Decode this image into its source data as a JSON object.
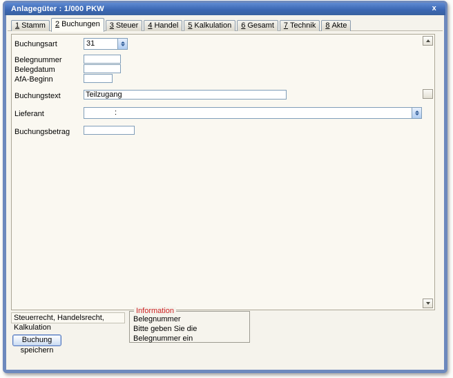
{
  "window": {
    "title": "Anlagegüter : 1/000 PKW",
    "close_label": "x"
  },
  "tabs": [
    {
      "num": "1",
      "label": "Stamm",
      "active": false
    },
    {
      "num": "2",
      "label": "Buchungen",
      "active": true
    },
    {
      "num": "3",
      "label": "Steuer",
      "active": false
    },
    {
      "num": "4",
      "label": "Handel",
      "active": false
    },
    {
      "num": "5",
      "label": "Kalkulation",
      "active": false
    },
    {
      "num": "6",
      "label": "Gesamt",
      "active": false
    },
    {
      "num": "7",
      "label": "Technik",
      "active": false
    },
    {
      "num": "8",
      "label": "Akte",
      "active": false
    }
  ],
  "form": {
    "buchungsart": {
      "label": "Buchungsart",
      "value": "31"
    },
    "belegnummer": {
      "label": "Belegnummer",
      "value": ""
    },
    "belegdatum": {
      "label": "Belegdatum",
      "value": ""
    },
    "afa_beginn": {
      "label": "AfA-Beginn",
      "value": ""
    },
    "buchungstext": {
      "label": "Buchungstext",
      "value": "Teilzugang"
    },
    "lieferant": {
      "label": "Lieferant",
      "value": ":"
    },
    "buchungsbetrag": {
      "label": "Buchungsbetrag",
      "value": ""
    }
  },
  "footer": {
    "scope_text": "Steuerrecht, Handelsrecht, Kalkulation",
    "save_button_label": "Buchung speichern",
    "info": {
      "title": "Information",
      "lines": [
        "Belegnummer",
        "Bitte geben Sie die Belegnummer ein"
      ]
    }
  },
  "colors": {
    "window_border": "#6d89bd",
    "titlebar_blue": "#3c68b4",
    "panel_bg": "#faf8f1",
    "page_bg": "#f5f3ec",
    "input_border": "#7f9db9",
    "info_title_red": "#cc2222",
    "button_border_blue": "#5276be"
  }
}
